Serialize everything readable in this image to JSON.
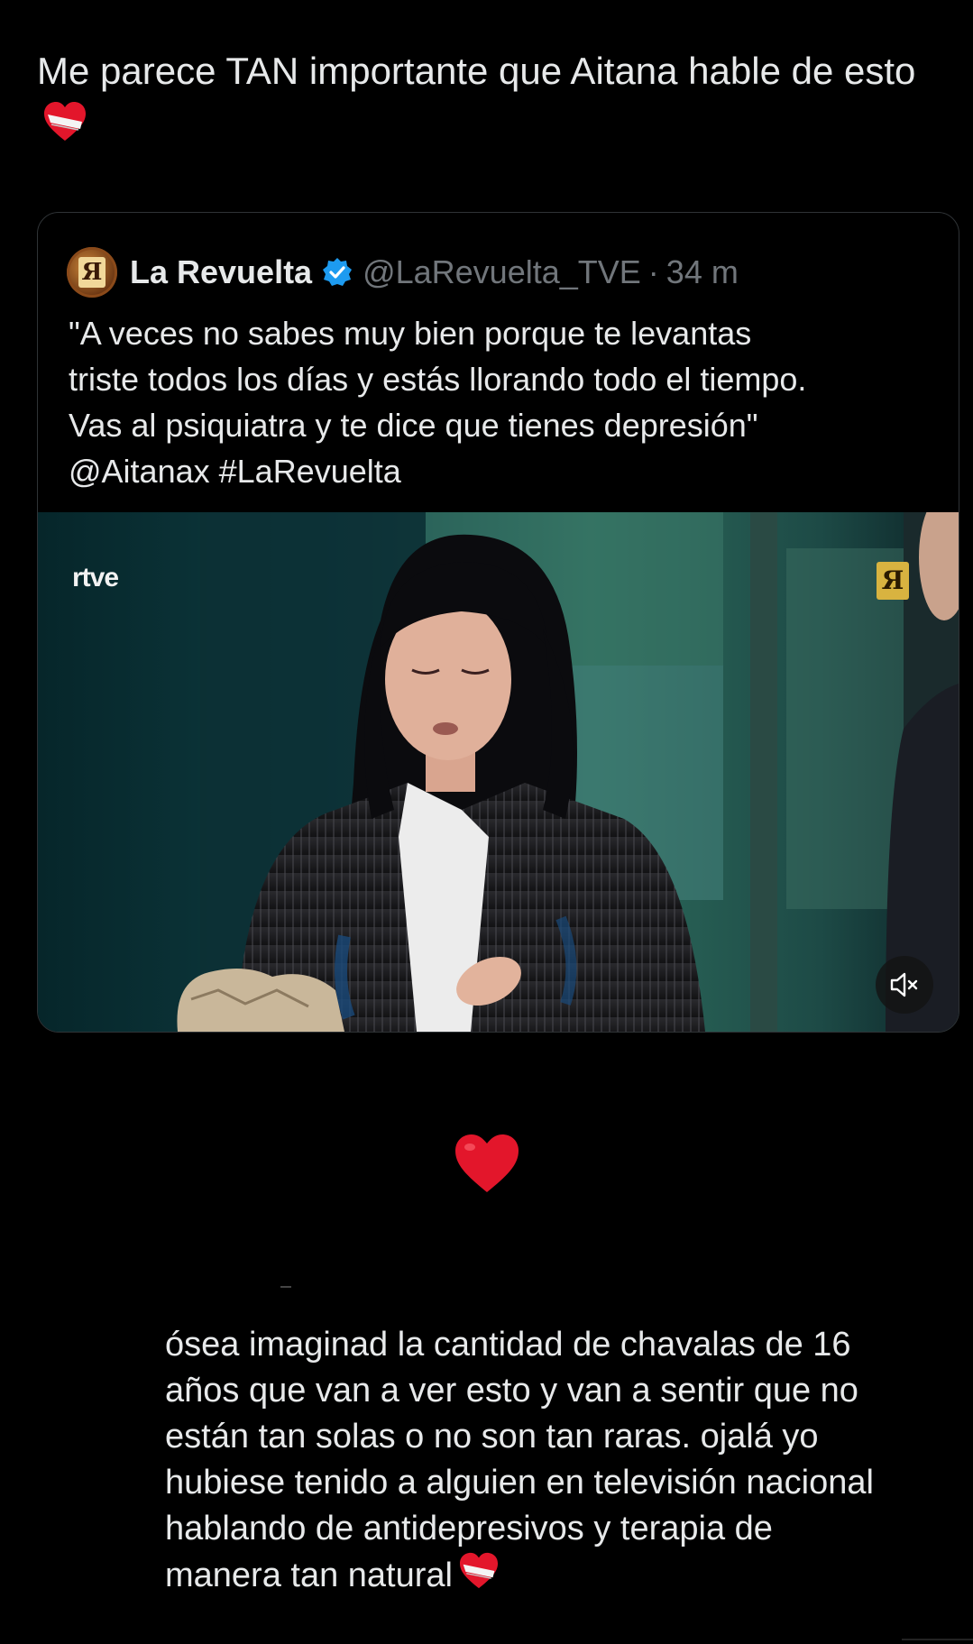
{
  "post": {
    "text": "Me parece TAN importante que Aitana hable de esto",
    "emoji": "mending-heart-icon"
  },
  "quote": {
    "name": "La Revuelta",
    "handle": "@LaRevuelta_TVE",
    "separator": "·",
    "time": "34 m",
    "avatar_glyph": "Я",
    "body_line1": "\"A veces no sabes muy bien porque te levantas",
    "body_line2": "triste todos los días y estás llorando todo el tiempo.",
    "body_line3": "Vas al psiquiatra y te dice que tienes depresión\"",
    "body_line4": "@Aitanax #LaRevuelta",
    "video": {
      "broadcaster_logo": "rtve",
      "channel_bug": "Я",
      "mute_icon": "speaker-muted-icon"
    }
  },
  "reaction": {
    "emoji": "red-heart-icon"
  },
  "reply": {
    "line1": "ósea imaginad la cantidad de chavalas de 16",
    "line2": "años que van a ver esto y van a sentir que no",
    "line3": "están tan solas o no son tan raras. ojalá yo",
    "line4": "hubiese tenido a alguien en televisión nacional",
    "line5": "hablando de antidepresivos y terapia de",
    "line6": "manera tan natural",
    "emoji": "mending-heart-icon"
  },
  "colors": {
    "background": "#000000",
    "text": "#e7e9ea",
    "muted": "#71767b",
    "verified": "#1d9bf0",
    "heart": "#e3162b"
  }
}
